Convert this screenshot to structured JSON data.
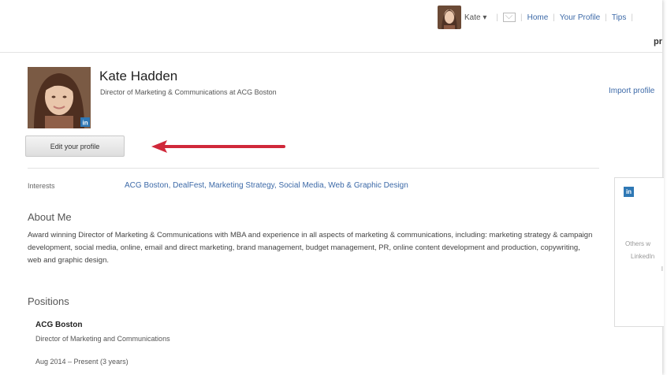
{
  "nav": {
    "user_name": "Kate",
    "user_caret": "▾",
    "separator": "|",
    "links": [
      "Home",
      "Your Profile",
      "Tips"
    ],
    "right_fragment": "pr"
  },
  "profile": {
    "name": "Kate Hadden",
    "headline": "Director of Marketing & Communications at ACG Boston",
    "import_link": "Import profile",
    "edit_button": "Edit your profile",
    "badge_text": "in"
  },
  "interests": {
    "label": "Interests",
    "value": "ACG Boston, DealFest, Marketing Strategy, Social Media, Web & Graphic Design"
  },
  "about": {
    "title": "About Me",
    "text": "Award winning Director of Marketing & Communications with MBA and experience in all aspects of marketing & communications, including: marketing strategy & campaign development, social media, online, email and direct marketing, brand management, budget management, PR, online content development and production, copywriting, web and graphic design."
  },
  "positions": {
    "title": "Positions",
    "items": [
      {
        "company": "ACG Boston",
        "role": "Director of Marketing and Communications",
        "dates": "Aug 2014 – Present (3 years)"
      }
    ]
  },
  "side_panel": {
    "badge": "in",
    "line1": "Others w",
    "line2": "LinkedIn",
    "line3": "l"
  },
  "colors": {
    "link": "#3d6aa8",
    "linkedin_blue": "#2f78b5",
    "arrow": "#d0283a"
  },
  "icons": [
    "mail-icon",
    "linkedin-icon",
    "caret-down-icon",
    "red-arrow-annotation"
  ]
}
